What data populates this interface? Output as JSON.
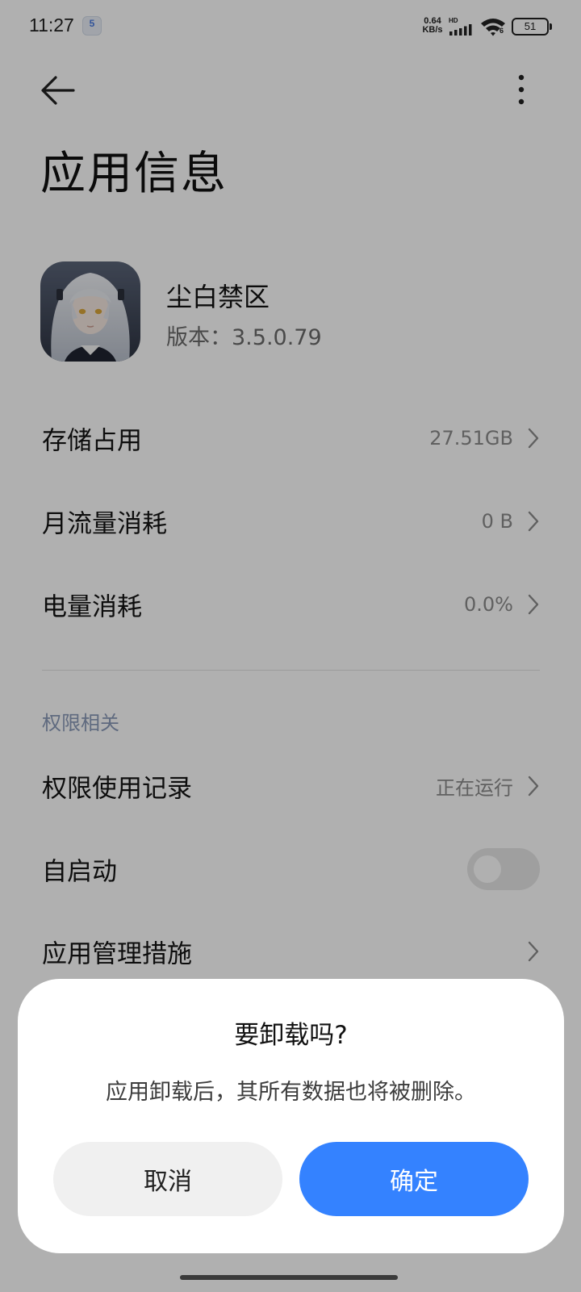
{
  "status_bar": {
    "time": "11:27",
    "notification_badge": "5",
    "net_speed_value": "0.64",
    "net_speed_unit": "KB/s",
    "hd": "HD",
    "wifi_sub": "6",
    "battery": "51"
  },
  "toolbar": {
    "back_icon": "arrow-left-icon",
    "more_icon": "more-vertical-icon"
  },
  "page": {
    "title": "应用信息"
  },
  "app": {
    "name": "尘白禁区",
    "version": "版本：3.5.0.79"
  },
  "rows": [
    {
      "label": "存储占用",
      "value": "27.51GB"
    },
    {
      "label": "月流量消耗",
      "value": "0 B"
    },
    {
      "label": "电量消耗",
      "value": "0.0%"
    }
  ],
  "permissions_section": {
    "header": "权限相关",
    "rows": [
      {
        "label": "权限使用记录",
        "value": "正在运行"
      },
      {
        "label": "自启动",
        "toggle_on": false
      },
      {
        "label": "应用管理措施"
      }
    ]
  },
  "dialog": {
    "title": "要卸载吗?",
    "message": "应用卸载后，其所有数据也将被删除。",
    "cancel_label": "取消",
    "confirm_label": "确定"
  },
  "colors": {
    "accent": "#3482ff",
    "section_header": "#8a9ab8",
    "scrim": "rgba(0,0,0,0.31)"
  }
}
